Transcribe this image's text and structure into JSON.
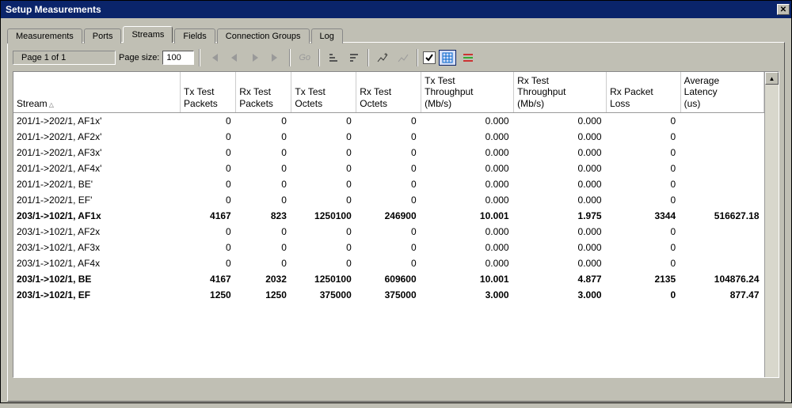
{
  "window": {
    "title": "Setup Measurements"
  },
  "tabs": [
    {
      "label": "Measurements",
      "active": false
    },
    {
      "label": "Ports",
      "active": false
    },
    {
      "label": "Streams",
      "active": true
    },
    {
      "label": "Fields",
      "active": false
    },
    {
      "label": "Connection Groups",
      "active": false
    },
    {
      "label": "Log",
      "active": false
    }
  ],
  "toolbar": {
    "page_status": "Page 1 of 1",
    "page_size_label": "Page size:",
    "page_size_value": "100",
    "go_label": "Go"
  },
  "columns": [
    "Stream",
    "Tx Test Packets",
    "Rx Test Packets",
    "Tx Test Octets",
    "Rx Test Octets",
    "Tx Test Throughput (Mb/s)",
    "Rx Test Throughput (Mb/s)",
    "Rx Packet Loss",
    "Average Latency (us)"
  ],
  "rows": [
    {
      "stream": "201/1->202/1, AF1x'",
      "tx_pkts": 0,
      "rx_pkts": 0,
      "tx_oct": 0,
      "rx_oct": 0,
      "tx_tp": "0.000",
      "rx_tp": "0.000",
      "rx_loss": 0,
      "lat": "",
      "bold": false
    },
    {
      "stream": "201/1->202/1, AF2x'",
      "tx_pkts": 0,
      "rx_pkts": 0,
      "tx_oct": 0,
      "rx_oct": 0,
      "tx_tp": "0.000",
      "rx_tp": "0.000",
      "rx_loss": 0,
      "lat": "",
      "bold": false
    },
    {
      "stream": "201/1->202/1, AF3x'",
      "tx_pkts": 0,
      "rx_pkts": 0,
      "tx_oct": 0,
      "rx_oct": 0,
      "tx_tp": "0.000",
      "rx_tp": "0.000",
      "rx_loss": 0,
      "lat": "",
      "bold": false
    },
    {
      "stream": "201/1->202/1, AF4x'",
      "tx_pkts": 0,
      "rx_pkts": 0,
      "tx_oct": 0,
      "rx_oct": 0,
      "tx_tp": "0.000",
      "rx_tp": "0.000",
      "rx_loss": 0,
      "lat": "",
      "bold": false
    },
    {
      "stream": "201/1->202/1, BE'",
      "tx_pkts": 0,
      "rx_pkts": 0,
      "tx_oct": 0,
      "rx_oct": 0,
      "tx_tp": "0.000",
      "rx_tp": "0.000",
      "rx_loss": 0,
      "lat": "",
      "bold": false
    },
    {
      "stream": "201/1->202/1, EF'",
      "tx_pkts": 0,
      "rx_pkts": 0,
      "tx_oct": 0,
      "rx_oct": 0,
      "tx_tp": "0.000",
      "rx_tp": "0.000",
      "rx_loss": 0,
      "lat": "",
      "bold": false
    },
    {
      "stream": "203/1->102/1, AF1x",
      "tx_pkts": 4167,
      "rx_pkts": 823,
      "tx_oct": 1250100,
      "rx_oct": 246900,
      "tx_tp": "10.001",
      "rx_tp": "1.975",
      "rx_loss": 3344,
      "lat": "516627.18",
      "bold": true
    },
    {
      "stream": "203/1->102/1, AF2x",
      "tx_pkts": 0,
      "rx_pkts": 0,
      "tx_oct": 0,
      "rx_oct": 0,
      "tx_tp": "0.000",
      "rx_tp": "0.000",
      "rx_loss": 0,
      "lat": "",
      "bold": false
    },
    {
      "stream": "203/1->102/1, AF3x",
      "tx_pkts": 0,
      "rx_pkts": 0,
      "tx_oct": 0,
      "rx_oct": 0,
      "tx_tp": "0.000",
      "rx_tp": "0.000",
      "rx_loss": 0,
      "lat": "",
      "bold": false
    },
    {
      "stream": "203/1->102/1, AF4x",
      "tx_pkts": 0,
      "rx_pkts": 0,
      "tx_oct": 0,
      "rx_oct": 0,
      "tx_tp": "0.000",
      "rx_tp": "0.000",
      "rx_loss": 0,
      "lat": "",
      "bold": false
    },
    {
      "stream": "203/1->102/1, BE",
      "tx_pkts": 4167,
      "rx_pkts": 2032,
      "tx_oct": 1250100,
      "rx_oct": 609600,
      "tx_tp": "10.001",
      "rx_tp": "4.877",
      "rx_loss": 2135,
      "lat": "104876.24",
      "bold": true
    },
    {
      "stream": "203/1->102/1, EF",
      "tx_pkts": 1250,
      "rx_pkts": 1250,
      "tx_oct": 375000,
      "rx_oct": 375000,
      "tx_tp": "3.000",
      "rx_tp": "3.000",
      "rx_loss": 0,
      "lat": "877.47",
      "bold": true
    }
  ]
}
